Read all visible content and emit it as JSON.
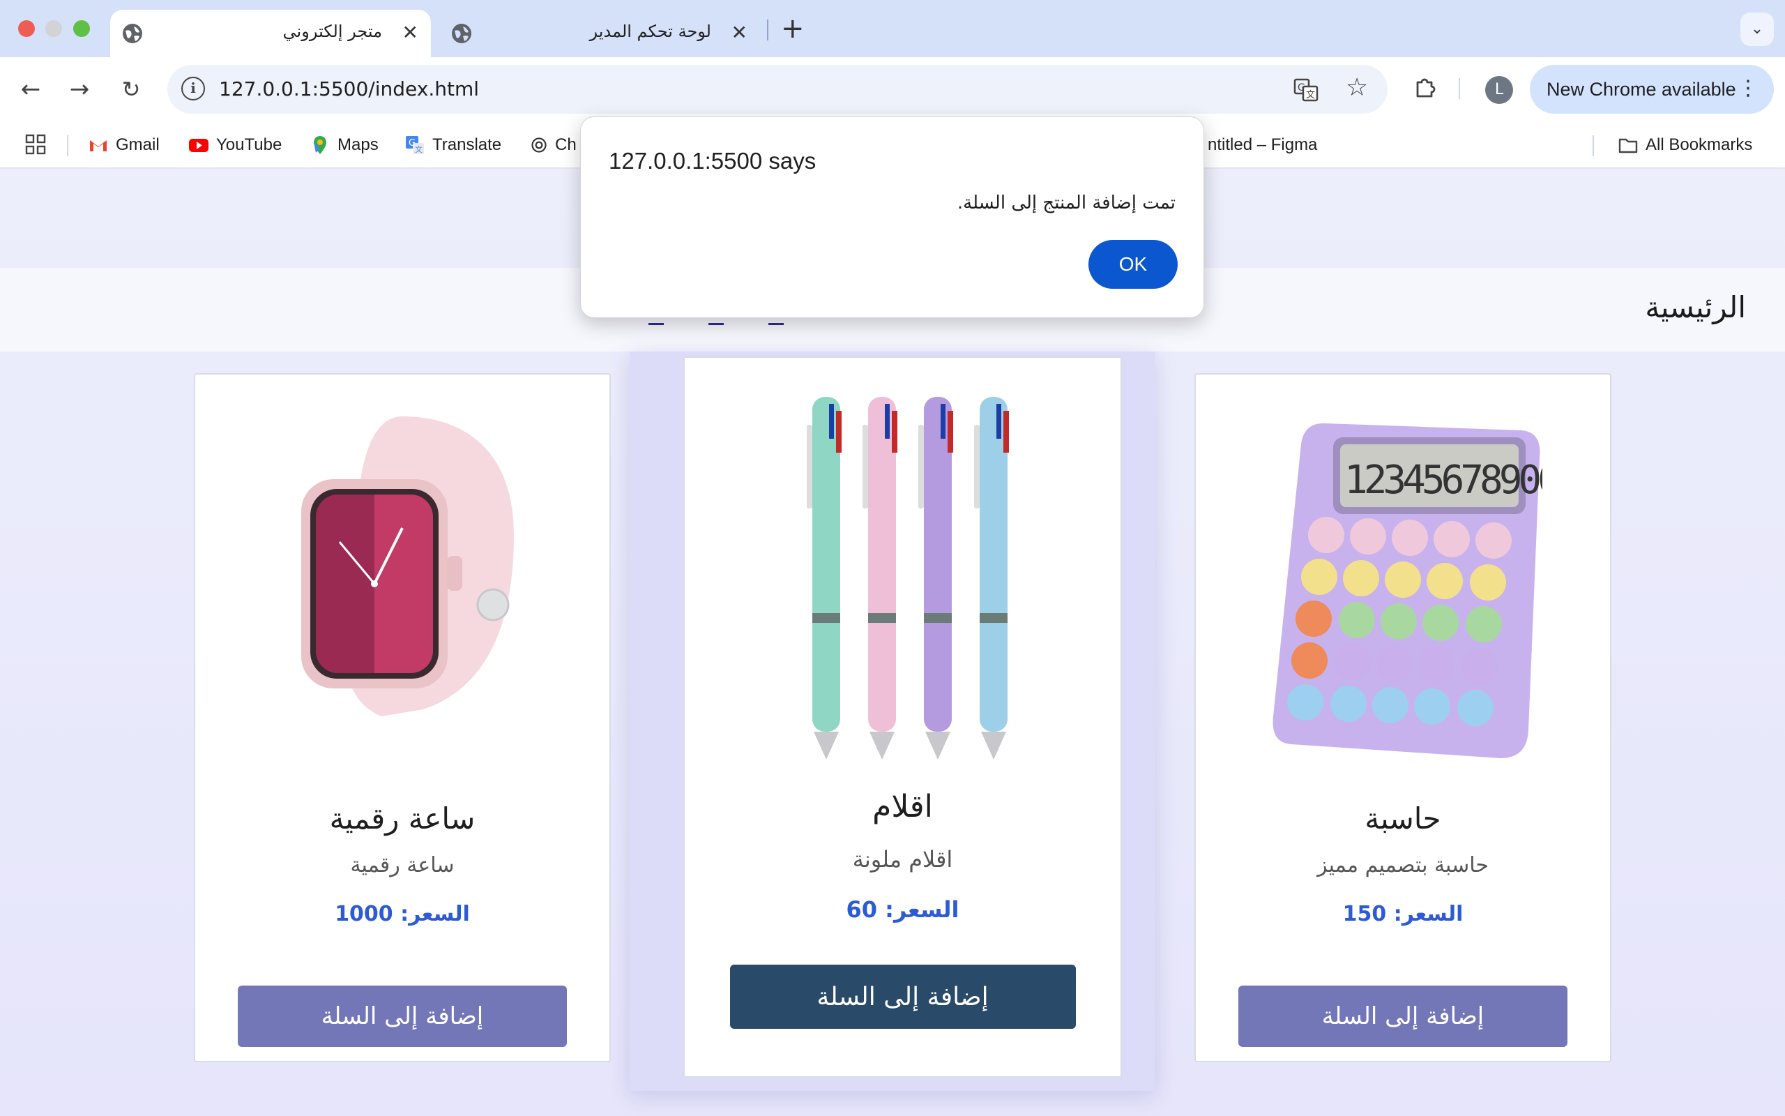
{
  "browser": {
    "tabs": [
      {
        "title": "متجر إلكتروني",
        "active": true
      },
      {
        "title": "لوحة تحكم المدير",
        "active": false
      }
    ],
    "address": "127.0.0.1:5500/index.html",
    "update_label": "New Chrome available",
    "avatar_initial": "L",
    "bookmarks": [
      {
        "label": "Gmail"
      },
      {
        "label": "YouTube"
      },
      {
        "label": "Maps"
      },
      {
        "label": "Translate"
      },
      {
        "label": "Ch"
      },
      {
        "label": "ntitled – Figma"
      }
    ],
    "all_bookmarks_label": "All Bookmarks"
  },
  "page": {
    "nav_home": "الرئيسية",
    "products": [
      {
        "name": "ساعة رقمية",
        "description": "ساعة رقمية",
        "price": "السعر: 1000",
        "button": "إضافة إلى السلة"
      },
      {
        "name": "اقلام",
        "description": "اقلام ملونة",
        "price": "السعر: 60",
        "button": "إضافة إلى السلة"
      },
      {
        "name": "حاسبة",
        "description": "حاسبة بتصميم مميز",
        "price": "السعر: 150",
        "button": "إضافة إلى السلة"
      }
    ]
  },
  "dialog": {
    "title": "127.0.0.1:5500 says",
    "message": "تمت إضافة المنتج إلى السلة.",
    "ok_label": "OK"
  },
  "colors": {
    "accent_blue": "#0b57d0",
    "price_blue": "#2d5bd6",
    "button_purple": "#7377b8",
    "button_dark": "#2a4a6a"
  }
}
